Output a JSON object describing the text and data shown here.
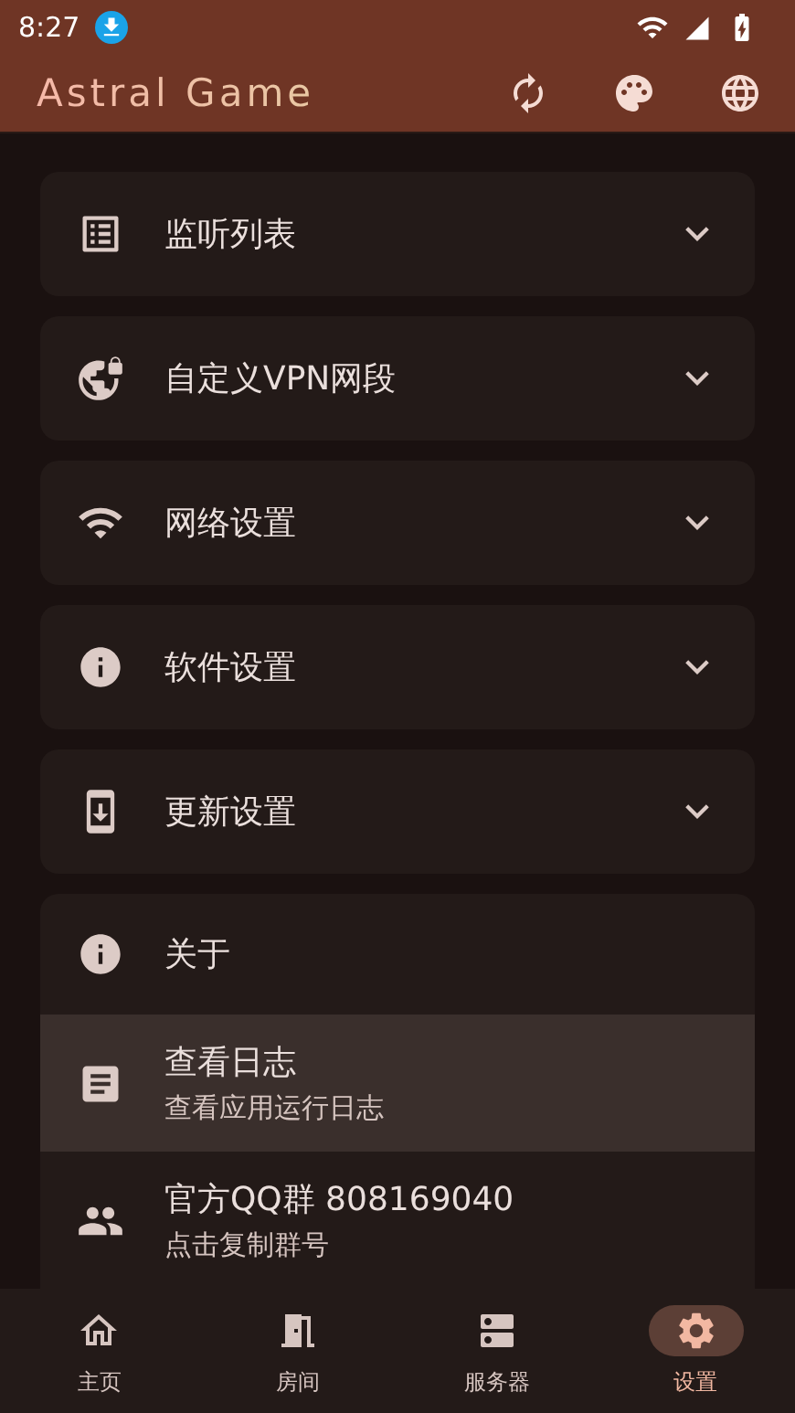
{
  "status_bar": {
    "time": "8:27"
  },
  "app_bar": {
    "title": "Astral Game"
  },
  "sections": [
    {
      "label": "监听列表",
      "expanded": false
    },
    {
      "label": "自定义VPN网段",
      "expanded": false
    },
    {
      "label": "网络设置",
      "expanded": false
    },
    {
      "label": "软件设置",
      "expanded": false
    },
    {
      "label": "更新设置",
      "expanded": false
    }
  ],
  "about": {
    "title": "关于",
    "rows": [
      {
        "title": "查看日志",
        "subtitle": "查看应用运行日志",
        "selected": true
      },
      {
        "title": "官方QQ群 808169040",
        "subtitle": "点击复制群号",
        "selected": false
      }
    ]
  },
  "bottom_nav": [
    {
      "label": "主页",
      "selected": false
    },
    {
      "label": "房间",
      "selected": false
    },
    {
      "label": "服务器",
      "selected": false
    },
    {
      "label": "设置",
      "selected": true
    }
  ]
}
